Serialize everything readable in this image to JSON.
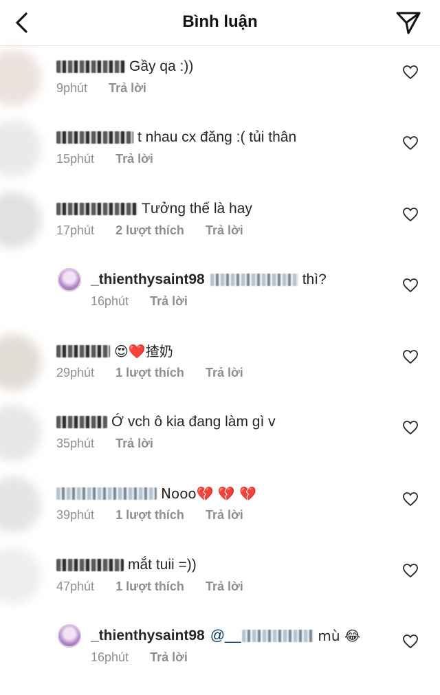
{
  "header": {
    "title": "Bình luận",
    "back_icon": "chevron-left-icon",
    "share_icon": "paper-plane-icon"
  },
  "comments": [
    {
      "text": "Gầy qa :))",
      "time": "9phút",
      "likes": "",
      "reply": "Trả lời"
    },
    {
      "text": "t nhau cx đăng :( tủi thân",
      "time": "15phút",
      "likes": "",
      "reply": "Trả lời"
    },
    {
      "text": "Tưởng thế là hay",
      "time": "17phút",
      "likes": "2 lượt thích",
      "reply": "Trả lời"
    },
    {
      "username": "_thienthysaint98",
      "text": "thì?",
      "time": "16phút",
      "likes": "",
      "reply": "Trả lời"
    },
    {
      "text": "😍❤️揸奶",
      "time": "29phút",
      "likes": "1 lượt thích",
      "reply": "Trả lời"
    },
    {
      "text": "Ớ vch ô kia đang làm gì v",
      "time": "35phút",
      "likes": "",
      "reply": "Trả lời"
    },
    {
      "text": "Nooo💔 💔 💔",
      "time": "39phút",
      "likes": "1 lượt thích",
      "reply": "Trả lời"
    },
    {
      "text": "mắt tuii =))",
      "time": "47phút",
      "likes": "1 lượt thích",
      "reply": "Trả lời"
    },
    {
      "username": "_thienthysaint98",
      "mention": "@__",
      "text": "mù 😂",
      "time": "16phút",
      "likes": "",
      "reply": "Trả lời"
    }
  ],
  "colors": {
    "text": "#262626",
    "meta": "#8e8e8e",
    "mention": "#00376b",
    "divider": "#e6e6e6"
  }
}
